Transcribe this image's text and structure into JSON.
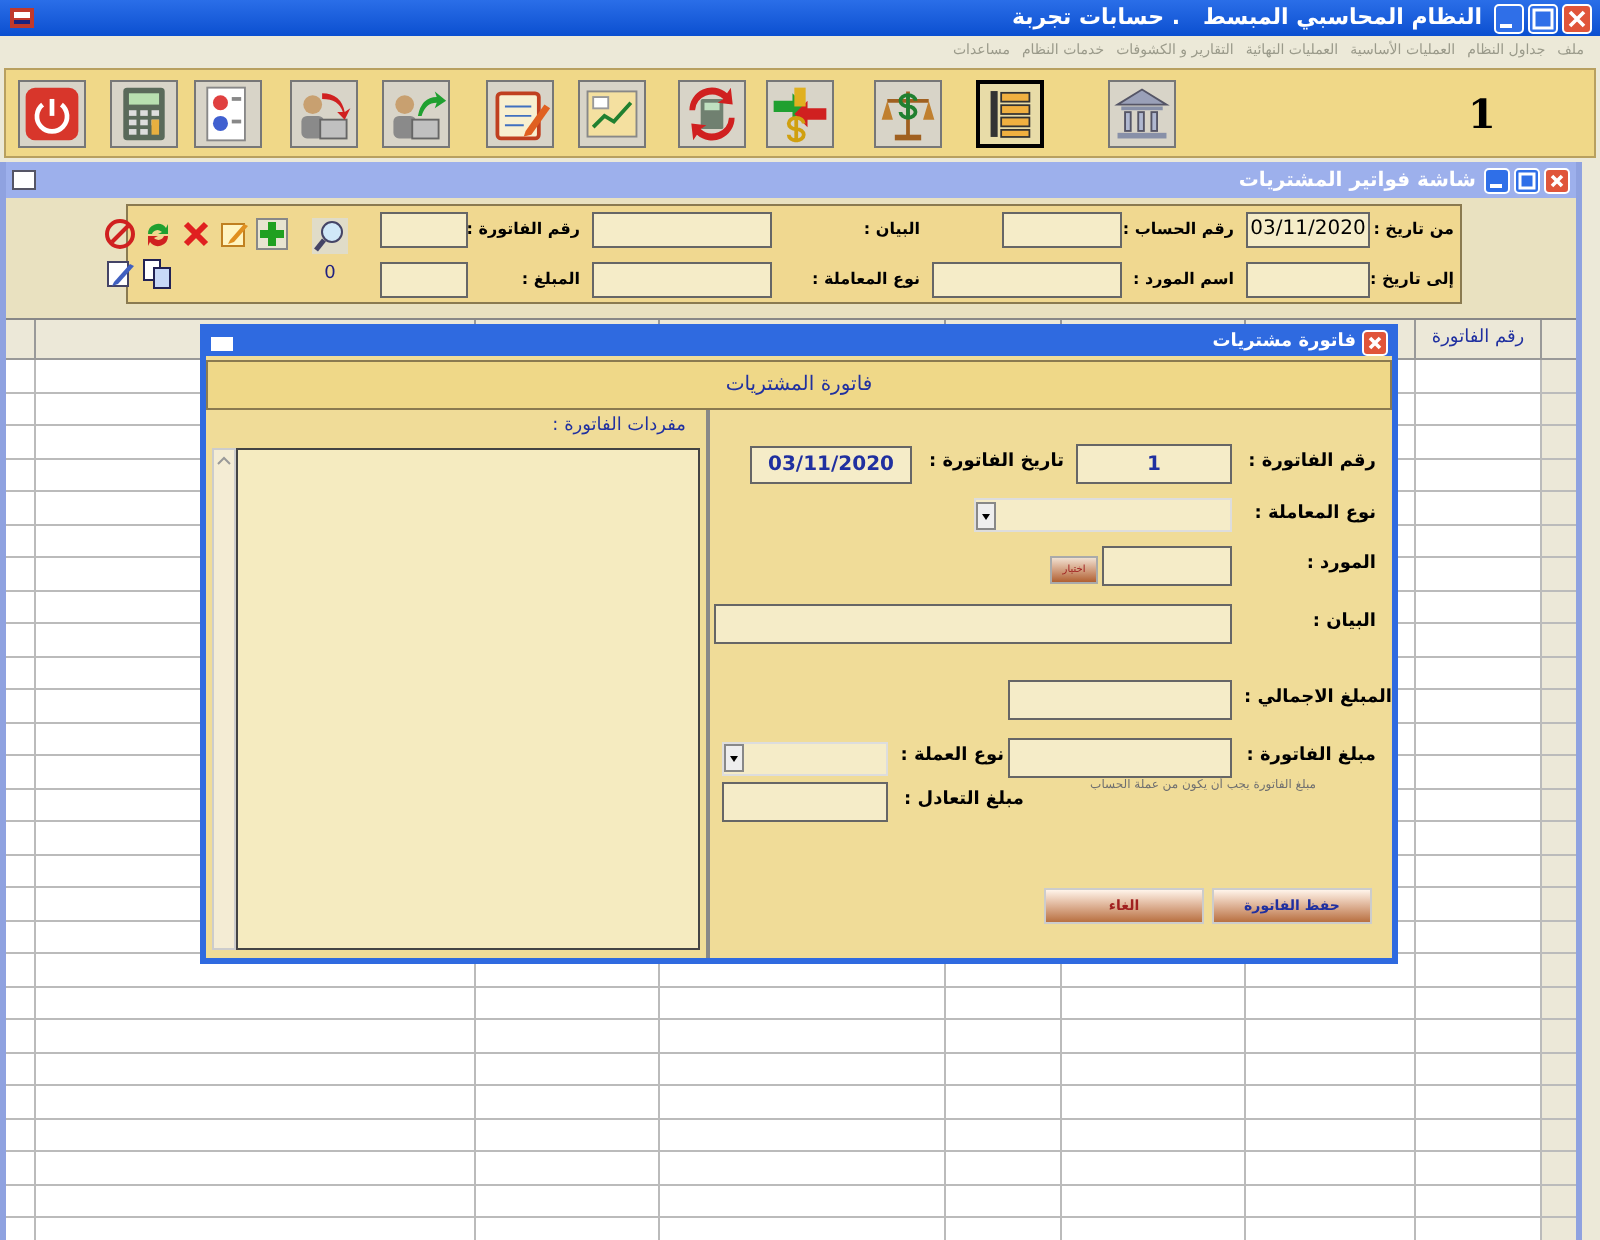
{
  "window": {
    "title": "النظام المحاسبي المبسط   . حسابات تجربة"
  },
  "menu": [
    {
      "label": "ملف",
      "disabled": true
    },
    {
      "label": "جداول النظام",
      "disabled": true
    },
    {
      "label": "العمليات الأساسية",
      "disabled": true
    },
    {
      "label": "العمليات النهائية",
      "disabled": true
    },
    {
      "label": "التقارير و الكشوفات",
      "disabled": true
    },
    {
      "label": "خدمات النظام",
      "disabled": true
    },
    {
      "label": "مساعدات",
      "disabled": true
    }
  ],
  "toolbar": {
    "buttons": [
      {
        "selected": false
      },
      {
        "selected": false
      },
      {
        "selected": false
      },
      {
        "selected": false
      },
      {
        "selected": false
      },
      {
        "selected": false
      },
      {
        "selected": false
      },
      {
        "selected": false
      },
      {
        "selected": false
      },
      {
        "selected": false
      },
      {
        "selected": true
      },
      {
        "selected": false
      }
    ],
    "counter": "1"
  },
  "purchases_window": {
    "title": "شاشة فواتير المشتريات",
    "filter": {
      "from_date": {
        "label": "من تاريخ :",
        "value": "03/11/2020"
      },
      "to_date": {
        "label": "إلى تاريخ :"
      },
      "account_number": {
        "label": "رقم الحساب :"
      },
      "supplier_name": {
        "label": "اسم المورد :"
      },
      "description": {
        "label": "البيان :"
      },
      "transaction_type": {
        "label": "نوع المعاملة :"
      },
      "invoice_number": {
        "label": "رقم الفاتورة :"
      },
      "amount": {
        "label": "المبلغ :"
      },
      "count": "0"
    },
    "table": {
      "columns": [
        "رقم الفاتورة"
      ]
    }
  },
  "invoice_dialog": {
    "title": "فاتورة مشتريات",
    "heading": "فاتورة المشتريات",
    "items_label": "مفردات الفاتورة :",
    "invoice_number": {
      "label": "رقم الفاتورة :",
      "value": "1"
    },
    "invoice_date": {
      "label": "تاريخ الفاتورة :",
      "value": "03/11/2020"
    },
    "transaction_type": {
      "label": "نوع المعاملة :"
    },
    "supplier": {
      "label": "المورد :",
      "button": "اختيار"
    },
    "description": {
      "label": "البيان :"
    },
    "total_amount": {
      "label": "المبلغ الاجمالي :"
    },
    "invoice_amount": {
      "label": "مبلغ الفاتورة :"
    },
    "currency": {
      "label": "نوع العملة :"
    },
    "note": "مبلغ الفاتورة يجب أن يكون من عملة الحساب",
    "equivalent_amount": {
      "label": "مبلغ التعادل :"
    },
    "buttons": [
      "حفظ الفاتورة",
      "الغاء"
    ]
  }
}
